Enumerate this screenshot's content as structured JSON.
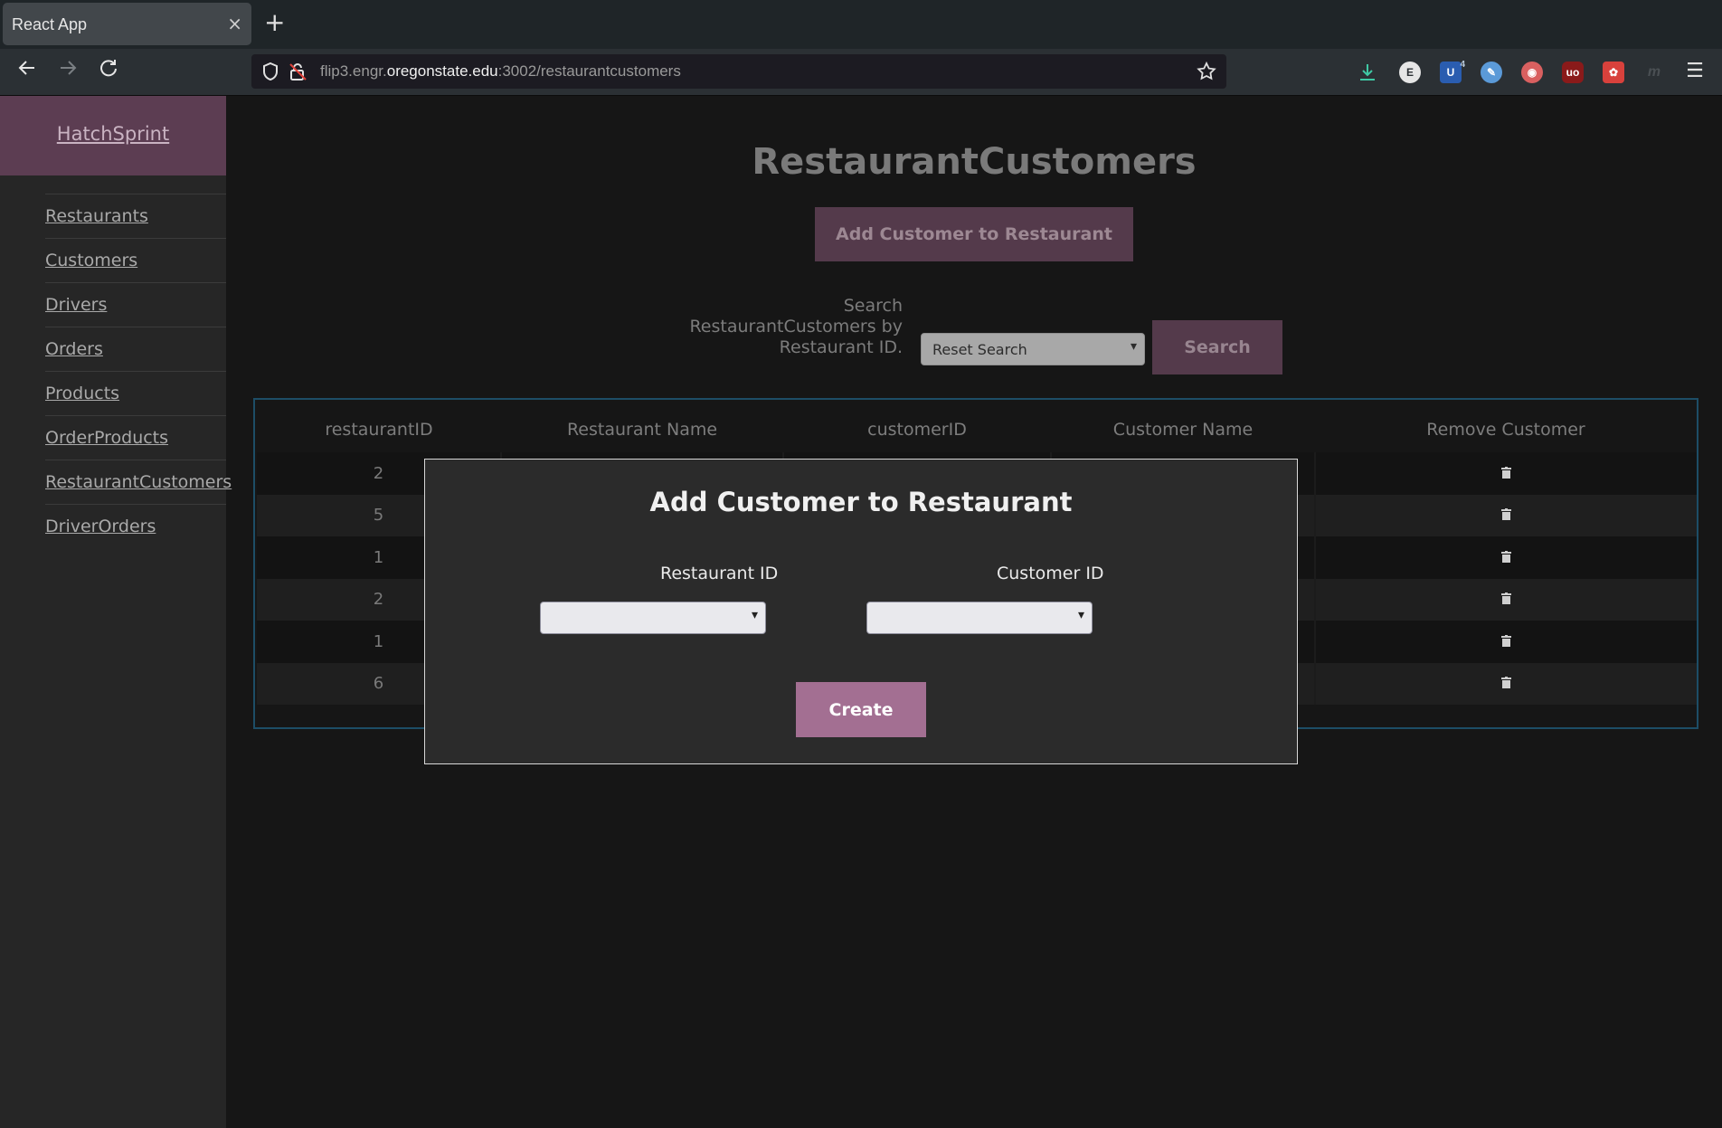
{
  "browser": {
    "tab_title": "React App",
    "tab_close": "×",
    "new_tab": "+",
    "url_host_prefix": "flip3.engr.",
    "url_host_domain": "oregonstate.edu",
    "url_path": ":3002/restaurantcustomers",
    "extension_badge": "4"
  },
  "sidebar": {
    "brand": "HatchSprint",
    "items": [
      {
        "label": "Restaurants"
      },
      {
        "label": "Customers"
      },
      {
        "label": "Drivers"
      },
      {
        "label": "Orders"
      },
      {
        "label": "Products"
      },
      {
        "label": "OrderProducts"
      },
      {
        "label": "RestaurantCustomers"
      },
      {
        "label": "DriverOrders"
      }
    ]
  },
  "main": {
    "title": "RestaurantCustomers",
    "add_button": "Add Customer to Restaurant",
    "search": {
      "label_line1": "Search",
      "label_line2": "RestaurantCustomers by",
      "label_line3": "Restaurant ID.",
      "selected": "Reset Search",
      "button": "Search"
    },
    "table": {
      "headers": [
        "restaurantID",
        "Restaurant Name",
        "customerID",
        "Customer Name",
        "Remove Customer"
      ],
      "rows": [
        {
          "restaurantID": "2"
        },
        {
          "restaurantID": "5"
        },
        {
          "restaurantID": "1"
        },
        {
          "restaurantID": "2"
        },
        {
          "restaurantID": "1"
        },
        {
          "restaurantID": "6"
        }
      ]
    }
  },
  "modal": {
    "title": "Add Customer to Restaurant",
    "restaurant_label": "Restaurant ID",
    "customer_label": "Customer ID",
    "restaurant_value": "",
    "customer_value": "",
    "create_button": "Create"
  },
  "colors": {
    "brand_bg": "#5c3d52",
    "button_bg": "#543a4b",
    "create_bg": "#a36f92",
    "table_border": "#1d4d66"
  }
}
